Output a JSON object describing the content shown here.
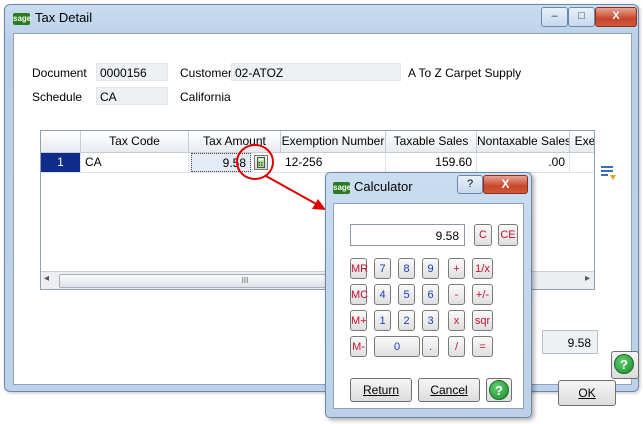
{
  "window": {
    "title": "Tax Detail",
    "app_logo": "sage",
    "controls": {
      "minimize": "–",
      "maximize": "□",
      "close": "X"
    }
  },
  "header": {
    "document_label": "Document",
    "document_value": "0000156",
    "customer_label": "Customer",
    "customer_value": "02-ATOZ",
    "customer_name": "A To Z Carpet Supply",
    "schedule_label": "Schedule",
    "schedule_value": "CA",
    "schedule_name": "California"
  },
  "grid": {
    "columns": [
      "",
      "Tax Code",
      "Tax Amount",
      "Exemption Number",
      "Taxable Sales",
      "Nontaxable Sales",
      "Exe"
    ],
    "rows": [
      {
        "num": "1",
        "tax_code": "CA",
        "tax_amount": "9.58",
        "exemption_number": "12-256",
        "taxable_sales": "159.60",
        "nontaxable_sales": ".00"
      }
    ],
    "scroll_left": "◂",
    "scroll_mid": "III",
    "scroll_right": "▸"
  },
  "total_value": "9.58",
  "buttons": {
    "ok": "OK",
    "help": "?"
  },
  "calculator": {
    "title": "Calculator",
    "logo": "sage",
    "help": "?",
    "close": "X",
    "display": "9.58",
    "keys": {
      "c": "C",
      "ce": "CE",
      "mr": "MR",
      "mc": "MC",
      "mplus": "M+",
      "mminus": "M-",
      "k7": "7",
      "k8": "8",
      "k9": "9",
      "plus": "+",
      "recip": "1/x",
      "k4": "4",
      "k5": "5",
      "k6": "6",
      "minus": "-",
      "negate": "+/-",
      "k1": "1",
      "k2": "2",
      "k3": "3",
      "times": "x",
      "sqr": "sqr",
      "k0": "0",
      "dot": ".",
      "divide": "/",
      "equals": "="
    },
    "return_label": "Return",
    "cancel_label": "Cancel"
  },
  "colors": {
    "row_selected": "#0f2c8c",
    "annotation_red": "#e00000",
    "help_green": "#1b8a2c"
  }
}
